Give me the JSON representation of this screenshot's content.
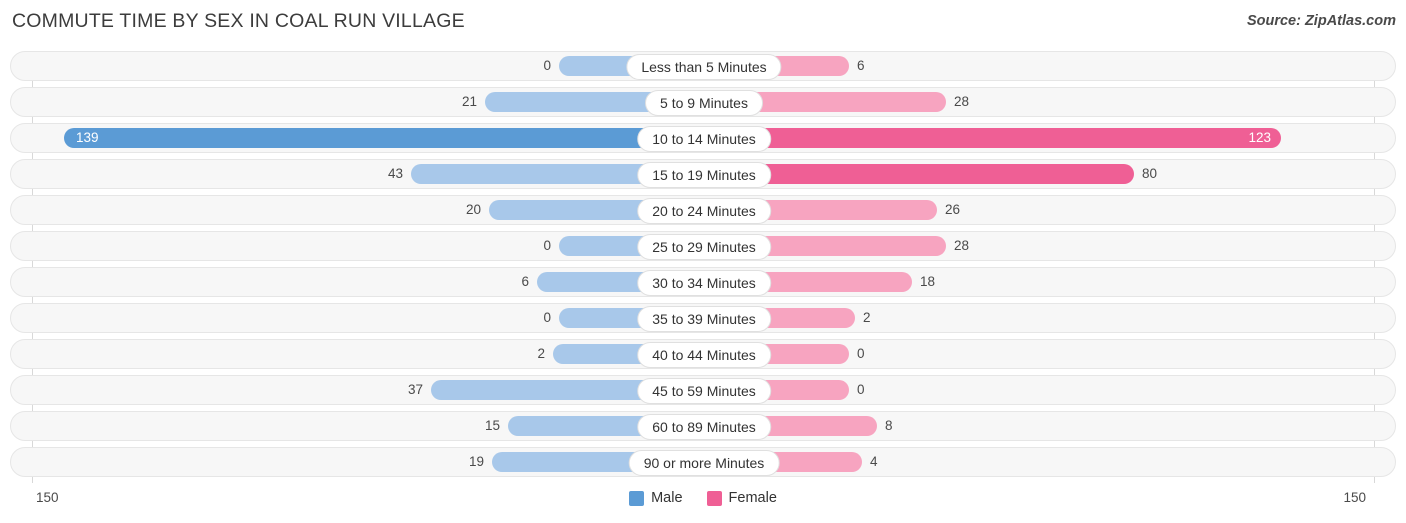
{
  "header": {
    "title": "COMMUTE TIME BY SEX IN COAL RUN VILLAGE",
    "source": "Source: ZipAtlas.com"
  },
  "legend": {
    "items": [
      {
        "label": "Male",
        "color": "#5B9BD5"
      },
      {
        "label": "Female",
        "color": "#ef5f95"
      }
    ]
  },
  "axis": {
    "left_end": "150",
    "right_end": "150"
  },
  "chart_data": {
    "type": "bar",
    "subtype": "diverging-bar",
    "title": "COMMUTE TIME BY SEX IN COAL RUN VILLAGE",
    "xlabel": "",
    "ylabel": "",
    "xlim": [
      150,
      150
    ],
    "grid": false,
    "legend_position": "bottom-center",
    "categories": [
      "Less than 5 Minutes",
      "5 to 9 Minutes",
      "10 to 14 Minutes",
      "15 to 19 Minutes",
      "20 to 24 Minutes",
      "25 to 29 Minutes",
      "30 to 34 Minutes",
      "35 to 39 Minutes",
      "40 to 44 Minutes",
      "45 to 59 Minutes",
      "60 to 89 Minutes",
      "90 or more Minutes"
    ],
    "series": [
      {
        "name": "Male",
        "values": [
          0,
          21,
          139,
          43,
          20,
          0,
          6,
          0,
          2,
          37,
          15,
          19
        ]
      },
      {
        "name": "Female",
        "values": [
          6,
          28,
          123,
          80,
          26,
          28,
          18,
          2,
          0,
          0,
          8,
          4
        ]
      }
    ]
  },
  "rows": [
    {
      "category": "Less than 5 Minutes",
      "male": "0",
      "female": "6",
      "male_w": 145,
      "female_w": 145,
      "male_hi": false,
      "female_hi": false,
      "male_inside": false,
      "female_inside": false
    },
    {
      "category": "5 to 9 Minutes",
      "male": "21",
      "female": "28",
      "male_w": 219,
      "female_w": 242,
      "male_hi": false,
      "female_hi": false,
      "male_inside": false,
      "female_inside": false
    },
    {
      "category": "10 to 14 Minutes",
      "male": "139",
      "female": "123",
      "male_w": 640,
      "female_w": 577,
      "male_hi": true,
      "female_hi": true,
      "male_inside": true,
      "female_inside": true
    },
    {
      "category": "15 to 19 Minutes",
      "male": "43",
      "female": "80",
      "male_w": 293,
      "female_w": 430,
      "male_hi": false,
      "female_hi": true,
      "male_inside": false,
      "female_inside": false
    },
    {
      "category": "20 to 24 Minutes",
      "male": "20",
      "female": "26",
      "male_w": 215,
      "female_w": 233,
      "male_hi": false,
      "female_hi": false,
      "male_inside": false,
      "female_inside": false
    },
    {
      "category": "25 to 29 Minutes",
      "male": "0",
      "female": "28",
      "male_w": 145,
      "female_w": 242,
      "male_hi": false,
      "female_hi": false,
      "male_inside": false,
      "female_inside": false
    },
    {
      "category": "30 to 34 Minutes",
      "male": "6",
      "female": "18",
      "male_w": 167,
      "female_w": 208,
      "male_hi": false,
      "female_hi": false,
      "male_inside": false,
      "female_inside": false
    },
    {
      "category": "35 to 39 Minutes",
      "male": "0",
      "female": "2",
      "male_w": 145,
      "female_w": 151,
      "male_hi": false,
      "female_hi": false,
      "male_inside": false,
      "female_inside": false
    },
    {
      "category": "40 to 44 Minutes",
      "male": "2",
      "female": "0",
      "male_w": 151,
      "female_w": 145,
      "male_hi": false,
      "female_hi": false,
      "male_inside": false,
      "female_inside": false
    },
    {
      "category": "45 to 59 Minutes",
      "male": "37",
      "female": "0",
      "male_w": 273,
      "female_w": 145,
      "male_hi": false,
      "female_hi": false,
      "male_inside": false,
      "female_inside": false
    },
    {
      "category": "60 to 89 Minutes",
      "male": "15",
      "female": "8",
      "male_w": 196,
      "female_w": 173,
      "male_hi": false,
      "female_hi": false,
      "male_inside": false,
      "female_inside": false
    },
    {
      "category": "90 or more Minutes",
      "male": "19",
      "female": "4",
      "male_w": 212,
      "female_w": 158,
      "male_hi": false,
      "female_hi": false,
      "male_inside": false,
      "female_inside": false
    }
  ]
}
